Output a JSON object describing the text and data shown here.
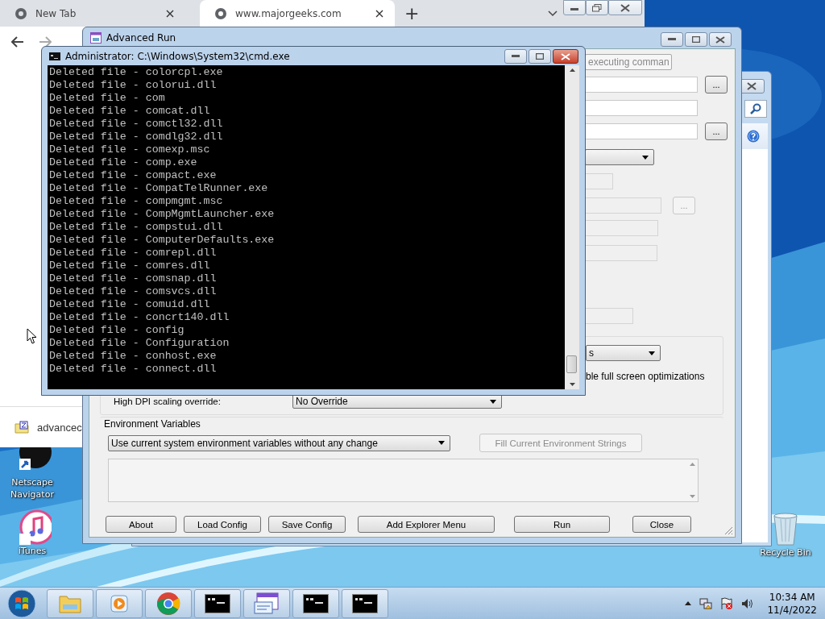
{
  "browser": {
    "tabs": [
      {
        "label": "New Tab",
        "selected": false
      },
      {
        "label": "www.majorgeeks.com",
        "selected": true
      }
    ],
    "new_tab": "+",
    "download": {
      "file": "advancec"
    }
  },
  "advanced_run": {
    "title": "Advanced Run",
    "fields": [
      {
        "kind": "combo",
        "value": "executing comman",
        "disabled": true
      },
      {
        "kind": "text",
        "disabled": false,
        "browse": "..."
      },
      {
        "kind": "text",
        "disabled": false
      },
      {
        "kind": "text",
        "disabled": false,
        "browse": "..."
      },
      {
        "kind": "dropdown",
        "disabled": false
      },
      {
        "kind": "text",
        "disabled": true
      },
      {
        "kind": "text",
        "disabled": true,
        "browse": "..."
      },
      {
        "kind": "text",
        "disabled": true
      },
      {
        "kind": "text",
        "disabled": true
      },
      {
        "kind": "text",
        "disabled": true
      }
    ],
    "compatibility": {
      "combo_value": "s",
      "option_text": "ble full screen optimizations",
      "dpi_label": "High DPI scaling override:",
      "dpi_value": "No Override"
    },
    "environment": {
      "title": "Environment Variables",
      "mode": "Use current system environment variables without any change",
      "fill_button": {
        "label": "Fill Current Environment Strings",
        "disabled": true
      }
    },
    "buttons": [
      "About",
      "Load Config",
      "Save Config",
      "Add Explorer Menu",
      "Run",
      "Close"
    ]
  },
  "cmd": {
    "title": "Administrator:  C:\\Windows\\System32\\cmd.exe",
    "lines": [
      "Deleted file - colorcpl.exe",
      "Deleted file - colorui.dll",
      "Deleted file - com",
      "Deleted file - comcat.dll",
      "Deleted file - comctl32.dll",
      "Deleted file - comdlg32.dll",
      "Deleted file - comexp.msc",
      "Deleted file - comp.exe",
      "Deleted file - compact.exe",
      "Deleted file - CompatTelRunner.exe",
      "Deleted file - compmgmt.msc",
      "Deleted file - CompMgmtLauncher.exe",
      "Deleted file - compstui.dll",
      "Deleted file - ComputerDefaults.exe",
      "Deleted file - comrepl.dll",
      "Deleted file - comres.dll",
      "Deleted file - comsnap.dll",
      "Deleted file - comsvcs.dll",
      "Deleted file - comuid.dll",
      "Deleted file - concrt140.dll",
      "Deleted file - config",
      "Deleted file - Configuration",
      "Deleted file - conhost.exe",
      "Deleted file - connect.dll"
    ]
  },
  "desktop_icons": [
    {
      "label": "Netscape Navigator",
      "kind": "netscape"
    },
    {
      "label": "iTunes",
      "kind": "itunes"
    },
    {
      "label": "Recycle Bin",
      "kind": "bin"
    }
  ],
  "taskbar": {
    "items": [
      {
        "kind": "folder"
      },
      {
        "kind": "media"
      },
      {
        "kind": "chrome"
      },
      {
        "kind": "console"
      },
      {
        "kind": "app"
      },
      {
        "kind": "console"
      },
      {
        "kind": "console"
      }
    ],
    "clock": {
      "time": "10:34 AM",
      "date": "11/4/2022"
    }
  }
}
